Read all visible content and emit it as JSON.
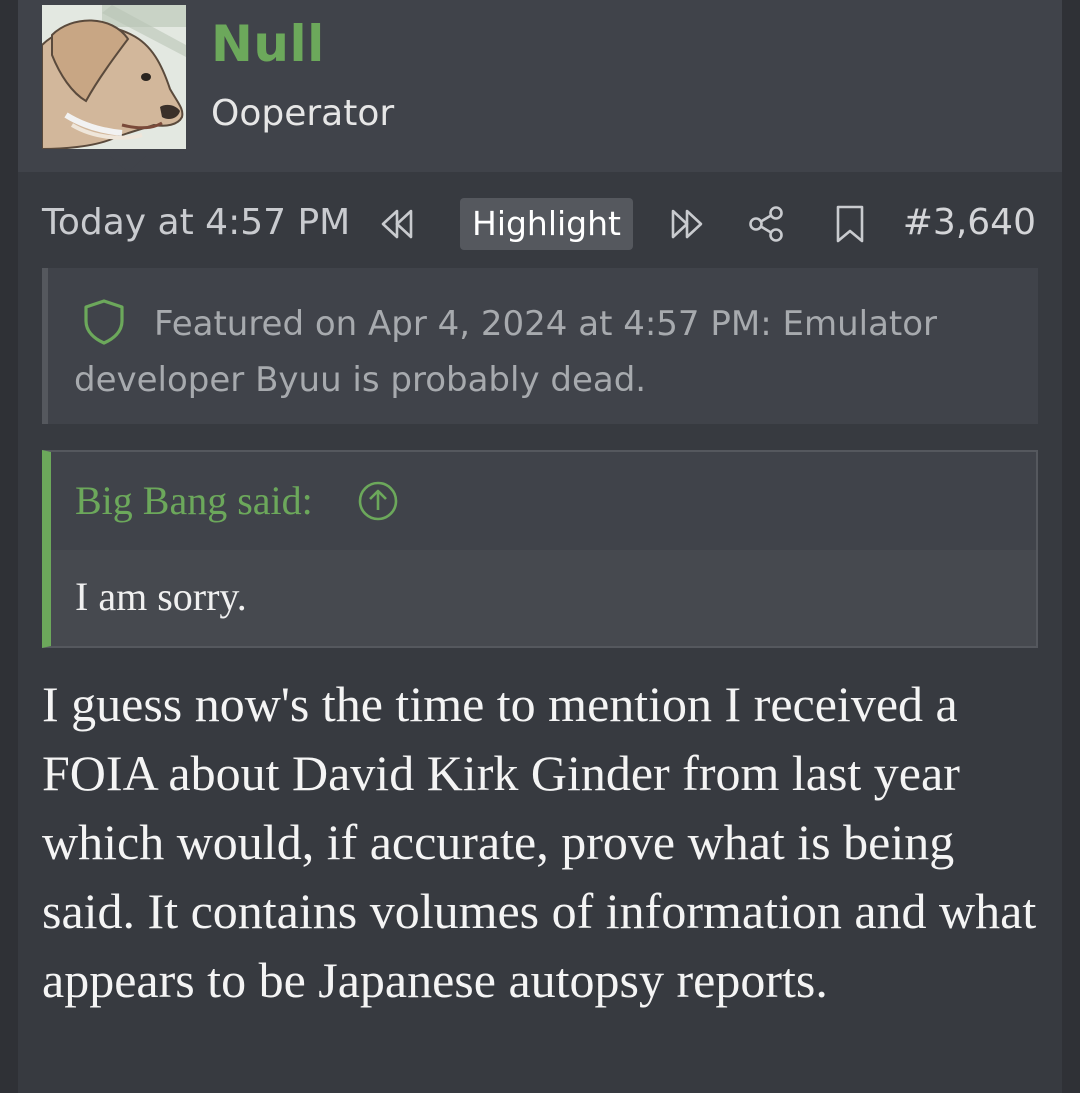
{
  "user": {
    "name": "Null",
    "title": "Ooperator"
  },
  "meta": {
    "timestamp": "Today at 4:57 PM",
    "highlight_label": "Highlight",
    "post_number": "#3,640",
    "icons": [
      "rewind-icon",
      "fast-forward-icon",
      "share-icon",
      "bookmark-icon"
    ]
  },
  "featured": {
    "text": "Featured on Apr 4, 2024 at 4:57 PM: Emulator developer Byuu is probably dead."
  },
  "quote": {
    "author": "Big Bang said:",
    "text": "I am sorry."
  },
  "body": {
    "text": "I guess now's the time to mention I received a FOIA about David Kirk Ginder from last year which would, if accurate, prove what is being said. It contains volumes of information and what appears to be Japanese autopsy reports."
  },
  "colors": {
    "accent_green": "#6ca85b",
    "post_bg": "#373a40",
    "header_bg": "#40434a"
  }
}
